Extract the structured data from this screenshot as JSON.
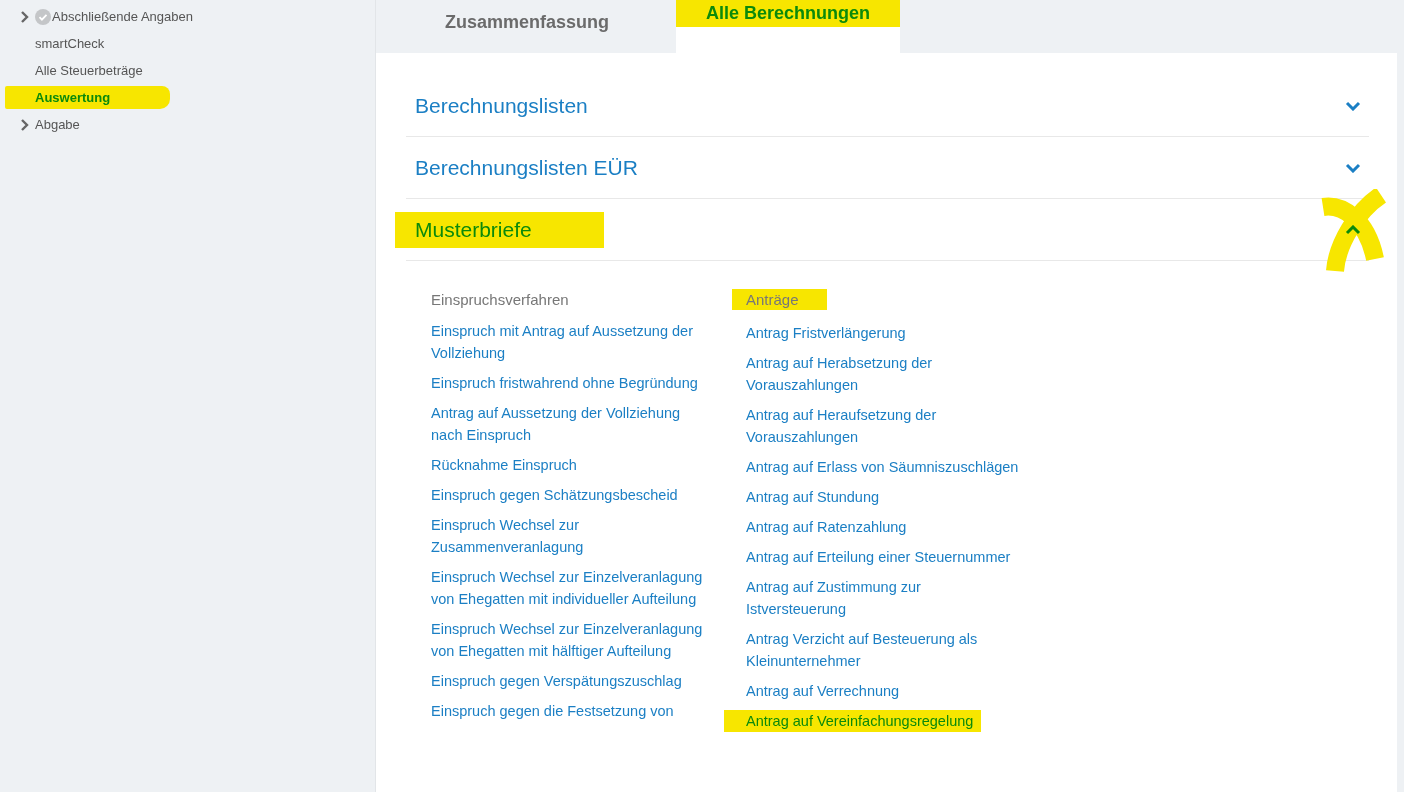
{
  "sidebar": {
    "items": [
      {
        "label": "Abschließende Angaben",
        "expandable": true,
        "done": true,
        "selected": false,
        "highlighted": false
      },
      {
        "label": "smartCheck",
        "expandable": false,
        "done": false,
        "selected": false,
        "highlighted": false
      },
      {
        "label": "Alle Steuerbeträge",
        "expandable": false,
        "done": false,
        "selected": false,
        "highlighted": false
      },
      {
        "label": "Auswertung",
        "expandable": false,
        "done": false,
        "selected": true,
        "highlighted": true
      },
      {
        "label": "Abgabe",
        "expandable": true,
        "done": false,
        "selected": false,
        "highlighted": false
      }
    ]
  },
  "tabs": [
    {
      "label": "Zusammenfassung",
      "selected": false,
      "highlighted": false
    },
    {
      "label": "Alle Berechnungen",
      "selected": true,
      "highlighted": true
    }
  ],
  "sections": [
    {
      "title": "Berechnungslisten",
      "expanded": false,
      "highlighted": false
    },
    {
      "title": "Berechnungslisten EÜR",
      "expanded": false,
      "highlighted": false
    },
    {
      "title": "Musterbriefe",
      "expanded": true,
      "highlighted": true,
      "columns": [
        {
          "heading": "Einspruchsverfahren",
          "highlighted": false,
          "links": [
            {
              "label": "Einspruch mit Antrag auf Aussetzung der Vollziehung",
              "highlighted": false
            },
            {
              "label": "Einspruch fristwahrend ohne Begründung",
              "highlighted": false
            },
            {
              "label": "Antrag auf Aussetzung der Vollziehung nach Einspruch",
              "highlighted": false
            },
            {
              "label": "Rücknahme Einspruch",
              "highlighted": false
            },
            {
              "label": "Einspruch gegen Schätzungsbescheid",
              "highlighted": false
            },
            {
              "label": "Einspruch Wechsel zur Zusammenveranlagung",
              "highlighted": false
            },
            {
              "label": "Einspruch Wechsel zur Einzelveranlagung von Ehegatten mit individueller Aufteilung",
              "highlighted": false
            },
            {
              "label": "Einspruch Wechsel zur Einzelveranlagung von Ehegatten mit hälftiger Aufteilung",
              "highlighted": false
            },
            {
              "label": "Einspruch gegen Verspätungszuschlag",
              "highlighted": false
            },
            {
              "label": "Einspruch gegen die Festsetzung von",
              "highlighted": false
            }
          ]
        },
        {
          "heading": "Anträge",
          "highlighted": true,
          "links": [
            {
              "label": "Antrag Fristverlängerung",
              "highlighted": false
            },
            {
              "label": "Antrag auf Herabsetzung der Vorauszahlungen",
              "highlighted": false
            },
            {
              "label": "Antrag auf Heraufsetzung der Vorauszahlungen",
              "highlighted": false
            },
            {
              "label": "Antrag auf Erlass von Säumniszuschlägen",
              "highlighted": false
            },
            {
              "label": "Antrag auf Stundung",
              "highlighted": false
            },
            {
              "label": "Antrag auf Ratenzahlung",
              "highlighted": false
            },
            {
              "label": "Antrag auf Erteilung einer Steuernummer",
              "highlighted": false
            },
            {
              "label": "Antrag auf Zustimmung zur Istversteuerung",
              "highlighted": false
            },
            {
              "label": "Antrag Verzicht auf Besteuerung als Kleinunternehmer",
              "highlighted": false
            },
            {
              "label": "Antrag auf Verrechnung",
              "highlighted": false
            },
            {
              "label": "Antrag auf Vereinfachungsregelung",
              "highlighted": true
            }
          ]
        }
      ]
    }
  ]
}
